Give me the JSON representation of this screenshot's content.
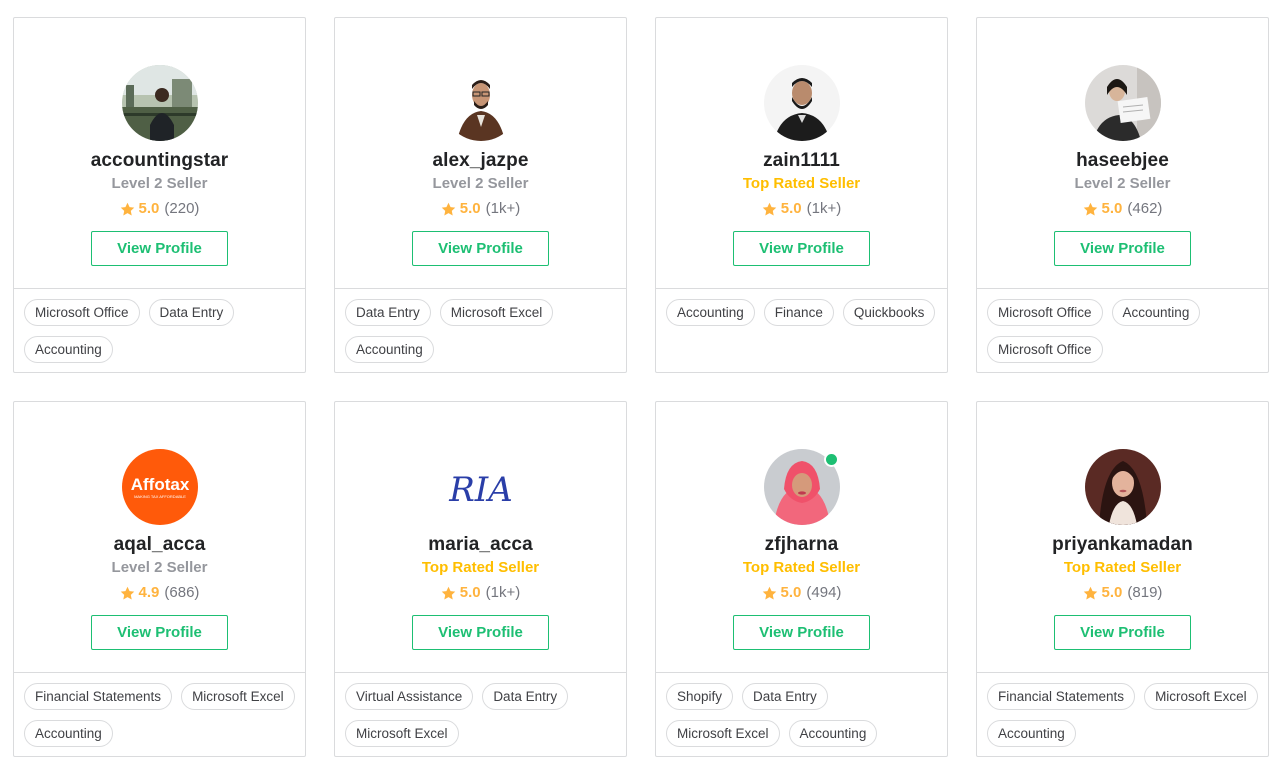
{
  "sellers": [
    {
      "username": "accountingstar",
      "level": "Level 2 Seller",
      "rating": "5.0",
      "reviews": "(220)",
      "button": "View Profile",
      "tags": [
        "Microsoft Office",
        "Data Entry",
        "Accounting"
      ]
    },
    {
      "username": "alex_jazpe",
      "level": "Level 2 Seller",
      "rating": "5.0",
      "reviews": "(1k+)",
      "button": "View Profile",
      "tags": [
        "Data Entry",
        "Microsoft Excel",
        "Accounting"
      ]
    },
    {
      "username": "zain1111",
      "level": "Top Rated Seller",
      "rating": "5.0",
      "reviews": "(1k+)",
      "button": "View Profile",
      "tags": [
        "Accounting",
        "Finance",
        "Quickbooks"
      ]
    },
    {
      "username": "haseebjee",
      "level": "Level 2 Seller",
      "rating": "5.0",
      "reviews": "(462)",
      "button": "View Profile",
      "tags": [
        "Microsoft Office",
        "Accounting",
        "Microsoft Office"
      ]
    },
    {
      "username": "aqal_acca",
      "level": "Level 2 Seller",
      "rating": "4.9",
      "reviews": "(686)",
      "button": "View Profile",
      "tags": [
        "Financial Statements",
        "Microsoft Excel",
        "Accounting"
      ],
      "avatar_logo": {
        "text": "Affotax",
        "tagline": "MAKING TAX AFFORDABLE"
      }
    },
    {
      "username": "maria_acca",
      "level": "Top Rated Seller",
      "rating": "5.0",
      "reviews": "(1k+)",
      "button": "View Profile",
      "tags": [
        "Virtual Assistance",
        "Data Entry",
        "Microsoft Excel"
      ],
      "avatar_logo": {
        "text": "RIA"
      }
    },
    {
      "username": "zfjharna",
      "level": "Top Rated Seller",
      "rating": "5.0",
      "reviews": "(494)",
      "button": "View Profile",
      "tags": [
        "Shopify",
        "Data Entry",
        "Microsoft Excel",
        "Accounting"
      ],
      "online": true
    },
    {
      "username": "priyankamadan",
      "level": "Top Rated Seller",
      "rating": "5.0",
      "reviews": "(819)",
      "button": "View Profile",
      "tags": [
        "Financial Statements",
        "Microsoft Excel",
        "Accounting"
      ]
    }
  ],
  "colors": {
    "accent": "#1dbf73",
    "top_rated": "#ffbe00",
    "level": "#95979d",
    "star": "#ffb33e",
    "border": "#dadbdd"
  },
  "icons": {
    "star": "star-icon",
    "online": "online-status-dot"
  }
}
